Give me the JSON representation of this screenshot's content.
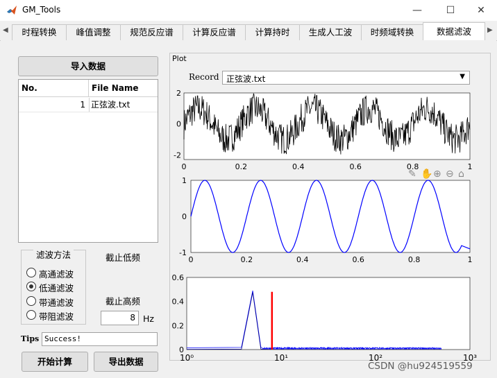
{
  "window": {
    "title": "GM_Tools",
    "minimize": "—",
    "maximize": "☐",
    "close": "✕"
  },
  "tabs": [
    {
      "label": "时程转换"
    },
    {
      "label": "峰值调整"
    },
    {
      "label": "规范反应谱"
    },
    {
      "label": "计算反应谱"
    },
    {
      "label": "计算持时"
    },
    {
      "label": "生成人工波"
    },
    {
      "label": "时频域转换"
    },
    {
      "label": "数据滤波",
      "active": true
    }
  ],
  "left": {
    "import_button": "导入数据",
    "table": {
      "columns": [
        "No.",
        "File Name"
      ],
      "rows": [
        {
          "no": "1",
          "file": "正弦波.txt"
        }
      ]
    },
    "filter_group": {
      "title": "滤波方法",
      "options": [
        {
          "label": "高通滤波",
          "selected": false
        },
        {
          "label": "低通滤波",
          "selected": true
        },
        {
          "label": "带通滤波",
          "selected": false
        },
        {
          "label": "带阻滤波",
          "selected": false
        }
      ]
    },
    "cutoff_low_label": "截止低频",
    "cutoff_high_label": "截止高频",
    "cutoff_high_value": "8",
    "cutoff_unit": "Hz",
    "tips_label": "Tips",
    "tips_value": "Success!",
    "compute_button": "开始计算",
    "export_button": "导出数据"
  },
  "plot_panel": {
    "title": "Plot",
    "record_label": "Record",
    "record_value": "正弦波.txt"
  },
  "watermark": "CSDN @hu924519559",
  "colors": {
    "signal_raw": "#000000",
    "signal_filtered": "#0000ff",
    "cutoff_marker": "#ff0000"
  },
  "chart_data": [
    {
      "type": "line",
      "title": "",
      "description_of_series": "noisy sine wave",
      "x_range": [
        0,
        1
      ],
      "ylim": [
        -2.3,
        2
      ],
      "xticks": [
        "0",
        "0.2",
        "0.4",
        "0.6",
        "0.8",
        "1"
      ],
      "yticks": [
        "2",
        "0",
        "-2"
      ],
      "series": [
        {
          "frequency_hz": 5,
          "amplitude": 1,
          "noise_amplitude": 1
        }
      ]
    },
    {
      "type": "line",
      "title": "",
      "x_range": [
        0,
        1
      ],
      "ylim": [
        -1,
        1
      ],
      "xticks": [
        "0",
        "0.2",
        "0.4",
        "0.6",
        "0.8",
        "1"
      ],
      "yticks": [
        "1",
        "0",
        "-1"
      ],
      "series": [
        {
          "frequency_hz": 5,
          "amplitude": 1,
          "end_x": 0.97,
          "end_y": -0.9
        }
      ]
    },
    {
      "type": "line",
      "title": "",
      "x_scale": "log",
      "x_range": [
        1,
        1000
      ],
      "ylim": [
        0,
        0.6
      ],
      "xticks": [
        "10⁰",
        "10¹",
        "10²",
        "10³"
      ],
      "yticks": [
        "0.6",
        "0.4",
        "0.2",
        "0"
      ],
      "series": [
        {
          "peak_x": 5,
          "peak_y": 0.49,
          "spectrum_end_x": 500
        }
      ],
      "cutoff_x": 8,
      "cutoff_y": 0.48
    }
  ]
}
